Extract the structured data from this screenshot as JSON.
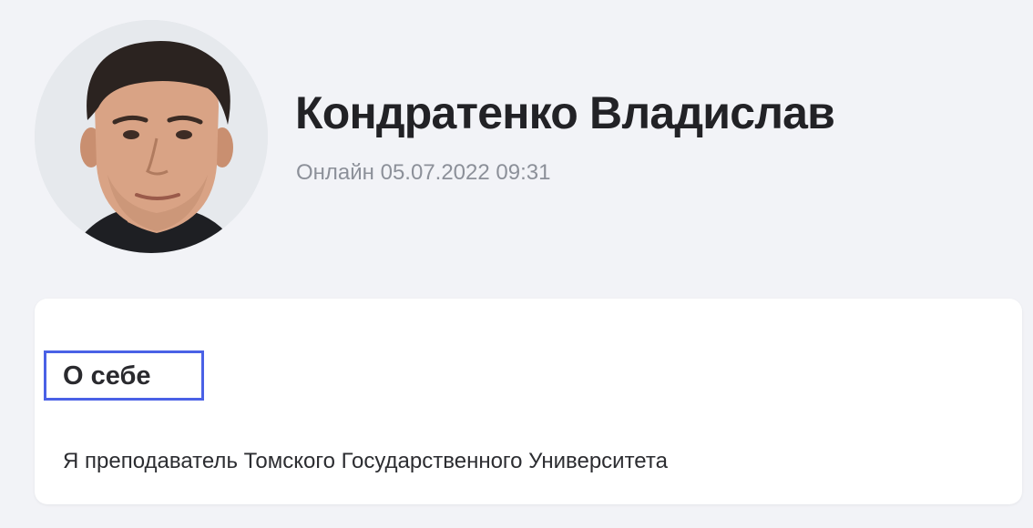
{
  "profile": {
    "name": "Кондратенко Владислав",
    "online_status": "Онлайн 05.07.2022 09:31",
    "avatar_icon": "user-photo"
  },
  "about": {
    "heading": "О себе",
    "text": "Я преподаватель Томского Государственного Университета"
  },
  "colors": {
    "background": "#f2f3f7",
    "card": "#ffffff",
    "name_text": "#222226",
    "status_text": "#8c9099",
    "highlight_border": "#4a61e6"
  }
}
